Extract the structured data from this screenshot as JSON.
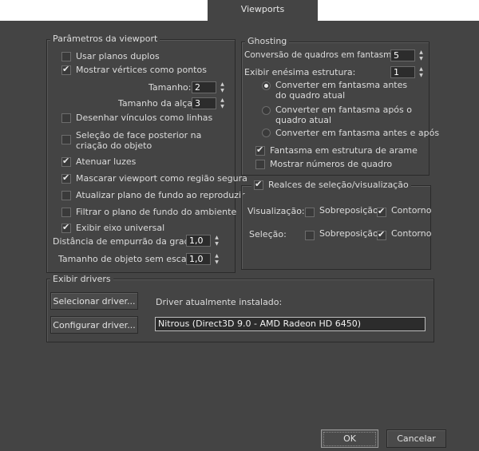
{
  "window": {
    "tab_label": "Viewports"
  },
  "viewport_params": {
    "legend": "Parâmetros da viewport",
    "dual_planes": {
      "label": "Usar planos duplos",
      "checked": false
    },
    "show_vertices": {
      "label": "Mostrar vértices como pontos",
      "checked": true
    },
    "size": {
      "label": "Tamanho:",
      "value": "2"
    },
    "handle_size": {
      "label": "Tamanho da alça:",
      "value": "3"
    },
    "draw_links": {
      "label": "Desenhar vínculos como linhas",
      "checked": false
    },
    "backface_select": {
      "label": "Seleção de face posterior na criação do objeto",
      "checked": false
    },
    "dim_lights": {
      "label": "Atenuar luzes",
      "checked": true
    },
    "safe_region": {
      "label": "Mascarar viewport como região segura",
      "checked": true
    },
    "update_bg": {
      "label": "Atualizar plano de fundo ao reproduzir",
      "checked": false
    },
    "filter_bg": {
      "label": "Filtrar o plano de fundo do ambiente",
      "checked": false
    },
    "universal_axis": {
      "label": "Exibir eixo universal",
      "checked": true
    },
    "grid_nudge": {
      "label": "Distância de empurrão da grade:",
      "value": "1,0"
    },
    "non_scaling": {
      "label": "Tamanho de objeto sem escala:",
      "value": "1,0"
    }
  },
  "ghosting": {
    "legend": "Ghosting",
    "ghost_frames": {
      "label": "Conversão de quadros em fantasma:",
      "value": "5"
    },
    "nth_frame": {
      "label": "Exibir enésima estrutura:",
      "value": "1"
    },
    "radio_before": {
      "label": "Converter em fantasma antes do quadro atual",
      "checked": true
    },
    "radio_after": {
      "label": "Converter em fantasma após o quadro atual",
      "checked": false
    },
    "radio_both": {
      "label": "Converter em fantasma antes e após",
      "checked": false
    },
    "wireframe": {
      "label": "Fantasma em estrutura de arame",
      "checked": true
    },
    "frame_numbers": {
      "label": "Mostrar números de quadro",
      "checked": false
    }
  },
  "highlights": {
    "legend": "Realces de seleção/visualização",
    "checked": true,
    "preview_label": "Visualização:",
    "selection_label": "Seleção:",
    "overlay_label": "Sobreposição",
    "outline_label": "Contorno",
    "preview_overlay": false,
    "preview_outline": true,
    "selection_overlay": false,
    "selection_outline": true
  },
  "drivers": {
    "legend": "Exibir drivers",
    "select_button": "Selecionar driver...",
    "configure_button": "Configurar driver...",
    "installed_label": "Driver atualmente instalado:",
    "installed_value": "Nitrous (Direct3D 9.0 - AMD Radeon HD 6450)"
  },
  "footer": {
    "ok": "OK",
    "cancel": "Cancelar"
  }
}
